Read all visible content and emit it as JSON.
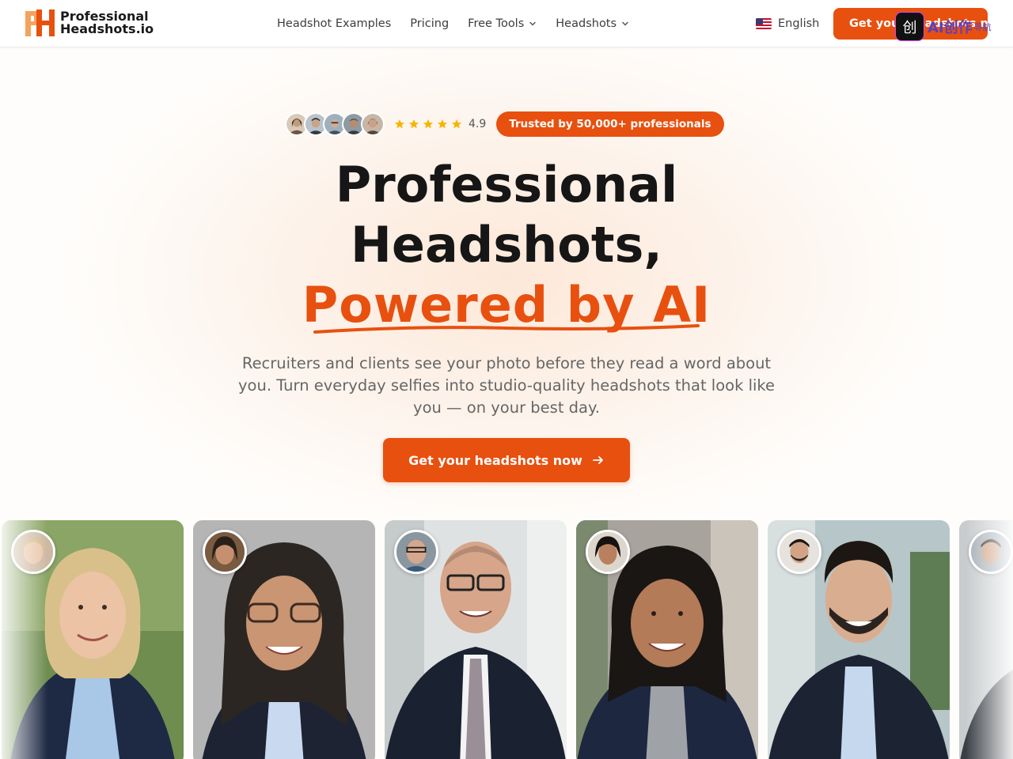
{
  "header": {
    "logo_line1": "Professional",
    "logo_line2": "Headshots.io",
    "nav": [
      {
        "label": "Headshot Examples",
        "dropdown": false
      },
      {
        "label": "Pricing",
        "dropdown": false
      },
      {
        "label": "Free Tools",
        "dropdown": true
      },
      {
        "label": "Headshots",
        "dropdown": true
      }
    ],
    "language": "English",
    "cta_label": "Get your headshots now",
    "watermark": {
      "text": "AI创作",
      "sub": "导航"
    }
  },
  "hero": {
    "rating": "4.9",
    "stars": 5,
    "trusted_badge": "Trusted by 50,000+ professionals",
    "title_line1": "Professional",
    "title_line2": "Headshots,",
    "title_line3": "Powered by AI",
    "subtitle": "Recruiters and clients see your photo before they read a word about you. Turn everyday selfies into studio-quality headshots that look like you — on your best day.",
    "cta_label": "Get your headshots now"
  },
  "colors": {
    "accent": "#e8500f",
    "text": "#161616",
    "muted": "#666666"
  },
  "icons": [
    "logo-icon",
    "chevron-down-icon",
    "us-flag-icon",
    "star-icon",
    "arrow-right-icon"
  ]
}
